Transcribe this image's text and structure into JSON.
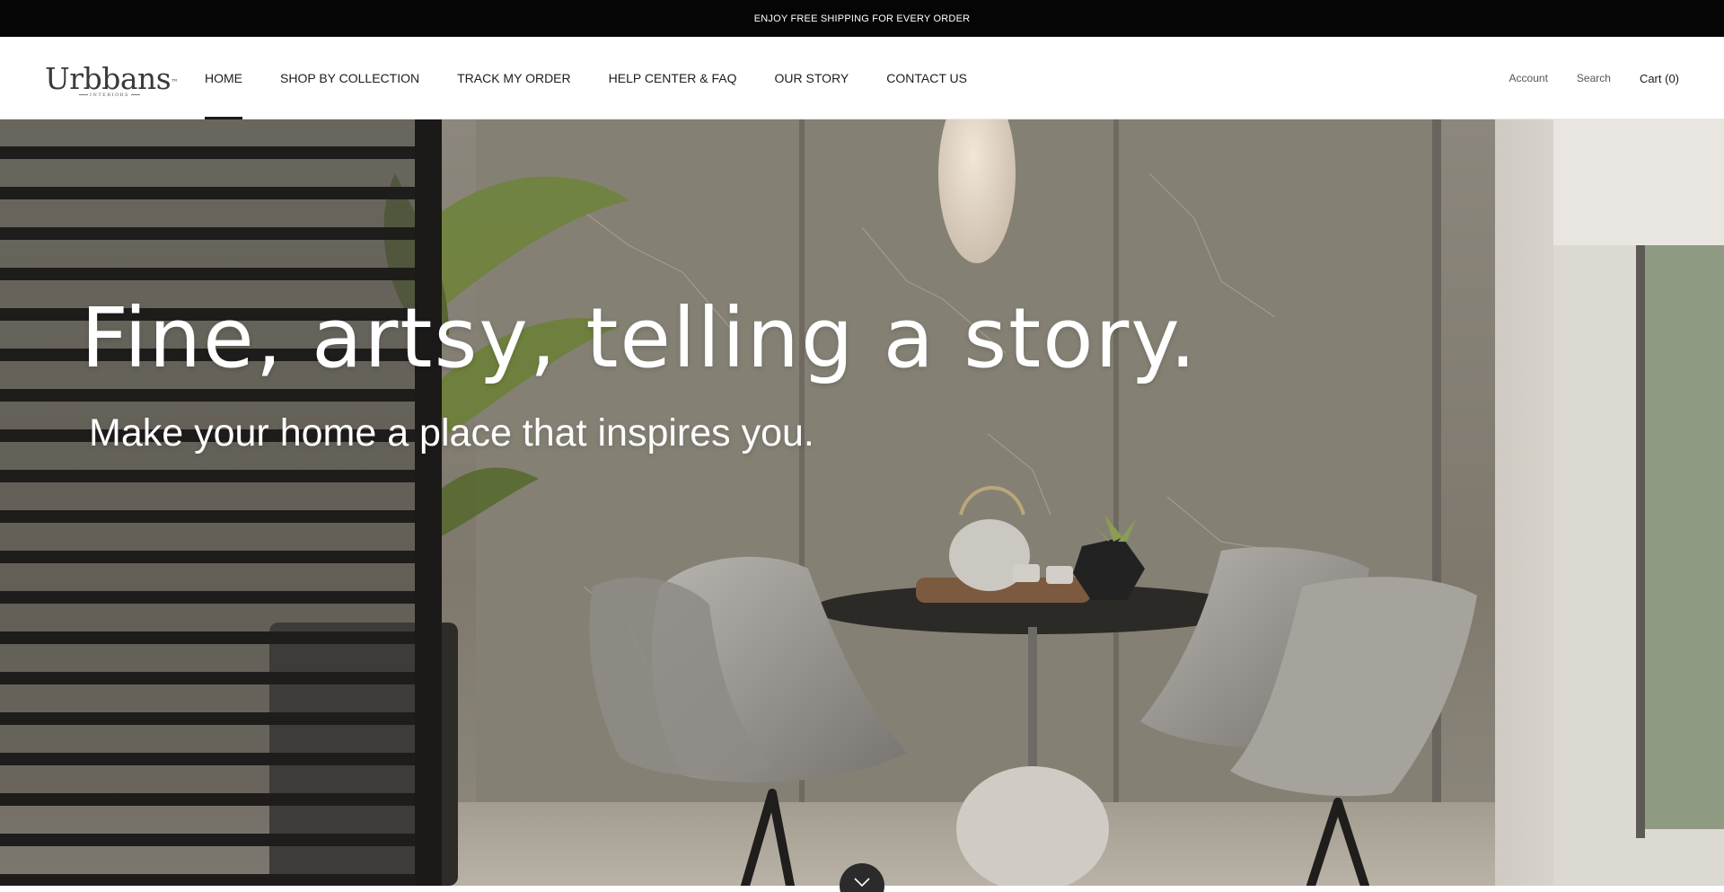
{
  "announcement": {
    "text": "ENJOY FREE SHIPPING FOR EVERY ORDER"
  },
  "header": {
    "logo": {
      "brand": "Urbbans",
      "trademark": "™",
      "tagline": "INTERIORS"
    },
    "nav": [
      {
        "label": "HOME",
        "active": true
      },
      {
        "label": "SHOP BY COLLECTION"
      },
      {
        "label": "TRACK MY ORDER"
      },
      {
        "label": "HELP CENTER & FAQ"
      },
      {
        "label": "OUR STORY"
      },
      {
        "label": "CONTACT US"
      }
    ],
    "account_label": "Account",
    "search_label": "Search",
    "cart_label": "Cart (0)"
  },
  "hero": {
    "title": "Fine, artsy, telling a story.",
    "subtitle": "Make your home a place that inspires you.",
    "scroll_icon": "chevron-down-icon"
  },
  "colors": {
    "announcement_bg": "#050505",
    "text": "#1c1c1c",
    "scroll_button": "#2b2b2b"
  }
}
